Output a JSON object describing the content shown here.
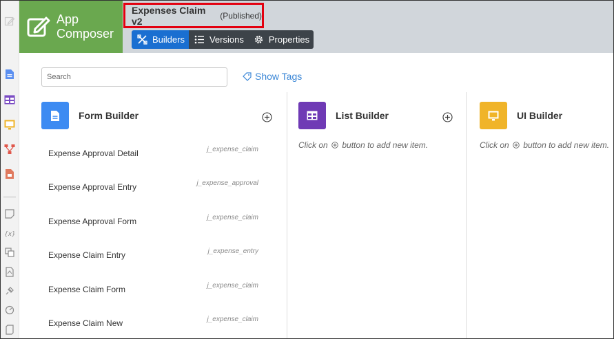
{
  "app": {
    "logo_line1": "App",
    "logo_line2": "Composer",
    "title": "Expenses Claim v2",
    "status": "(Published)",
    "brand_color": "#6aa84f",
    "accent_color": "#1a6fd1"
  },
  "tabs": [
    {
      "label": "Builders",
      "icon": "builders-icon",
      "active": true
    },
    {
      "label": "Versions",
      "icon": "list-icon",
      "active": false
    },
    {
      "label": "Properties",
      "icon": "gear-icon",
      "active": false
    }
  ],
  "search": {
    "placeholder": "Search"
  },
  "show_tags": {
    "label": "Show Tags"
  },
  "rail": [
    "pencil-icon",
    "form-icon",
    "list-icon",
    "ui-icon",
    "process-icon",
    "report-icon",
    "note-icon",
    "variable-icon",
    "resource-icon",
    "pdf-icon",
    "plugin-icon",
    "gauge-icon",
    "scroll-icon"
  ],
  "columns": {
    "form": {
      "title": "Form Builder",
      "badge_color": "#3d8bf2",
      "items": [
        {
          "name": "Expense Approval Detail",
          "table": "j_expense_claim"
        },
        {
          "name": "Expense Approval Entry",
          "table": "j_expense_approval"
        },
        {
          "name": "Expense Approval Form",
          "table": "j_expense_claim"
        },
        {
          "name": "Expense Claim Entry",
          "table": "j_expense_entry"
        },
        {
          "name": "Expense Claim Form",
          "table": "j_expense_claim"
        },
        {
          "name": "Expense Claim New",
          "table": "j_expense_claim"
        }
      ]
    },
    "list": {
      "title": "List Builder",
      "badge_color": "#6f3ab5",
      "hint_before": "Click on",
      "hint_after": "button to add new item."
    },
    "ui": {
      "title": "UI Builder",
      "badge_color": "#f0b429",
      "hint_before": "Click on",
      "hint_after": "button to add new item."
    }
  }
}
